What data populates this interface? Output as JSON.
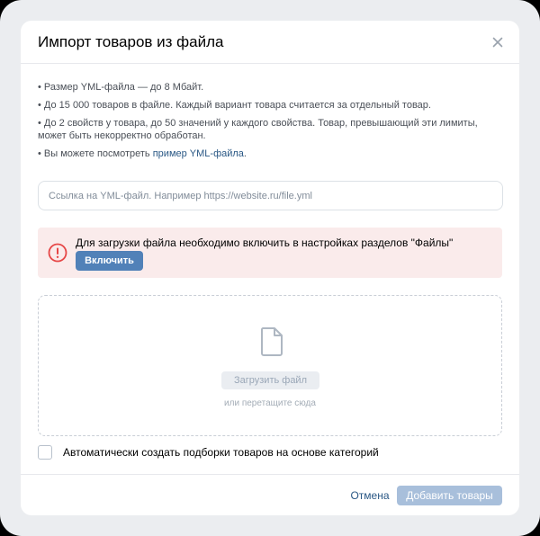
{
  "modal": {
    "title": "Импорт товаров из файла",
    "close_icon": "close-icon"
  },
  "info": {
    "line1": "• Размер YML-файла — до 8 Мбайт.",
    "line2": "• До 15 000 товаров в файле. Каждый вариант товара считается за отдельный товар.",
    "line3": "• До 2 свойств у товара, до 50 значений у каждого свойства. Товар, превышающий эти лимиты, может быть некорректно обработан.",
    "line4_prefix": "• Вы можете посмотреть ",
    "line4_link": "пример YML-файла",
    "line4_suffix": "."
  },
  "url_input": {
    "placeholder": "Ссылка на YML-файл. Например https://website.ru/file.yml",
    "value": ""
  },
  "alert": {
    "icon": "error-circle-icon",
    "text": "Для загрузки файла необходимо включить в настройках разделов \"Файлы\"",
    "button_label": "Включить",
    "color": "#e64646"
  },
  "dropzone": {
    "icon": "document-icon",
    "upload_label": "Загрузить файл",
    "hint": "или перетащите сюда"
  },
  "checkbox": {
    "label": "Автоматически создать подборки товаров на основе категорий",
    "checked": false
  },
  "footer": {
    "cancel_label": "Отмена",
    "submit_label": "Добавить товары"
  }
}
